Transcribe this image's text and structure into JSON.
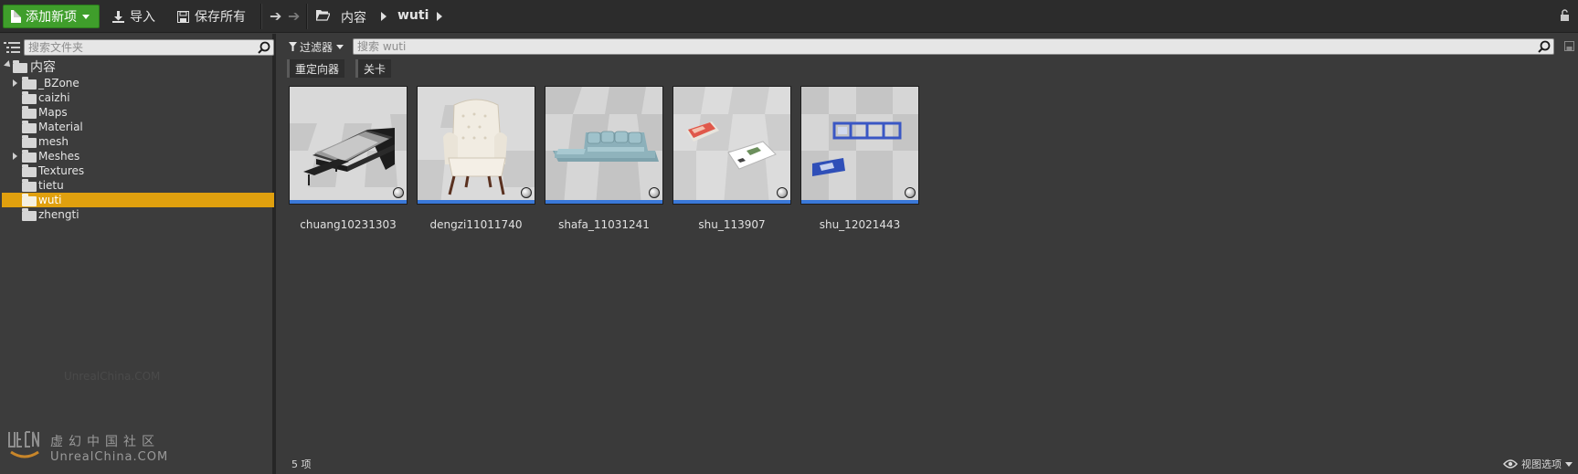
{
  "toolbar": {
    "add_new_label": "添加新项",
    "import_label": "导入",
    "save_all_label": "保存所有",
    "breadcrumb": [
      "内容",
      "wuti"
    ]
  },
  "sources": {
    "search_placeholder": "搜索文件夹",
    "tree": {
      "root": "内容",
      "items": [
        {
          "label": "_BZone",
          "expandable": true
        },
        {
          "label": "caizhi",
          "expandable": false
        },
        {
          "label": "Maps",
          "expandable": false
        },
        {
          "label": "Material",
          "expandable": false
        },
        {
          "label": "mesh",
          "expandable": false
        },
        {
          "label": "Meshes",
          "expandable": true
        },
        {
          "label": "Textures",
          "expandable": false
        },
        {
          "label": "tietu",
          "expandable": false
        },
        {
          "label": "wuti",
          "expandable": false,
          "selected": true
        },
        {
          "label": "zhengti",
          "expandable": false
        }
      ]
    }
  },
  "content": {
    "filter_label": "过滤器",
    "search_placeholder": "搜索 wuti",
    "chips": [
      "重定向器",
      "关卡"
    ],
    "assets": [
      {
        "name": "chuang10231303",
        "icon": "bed-thumbnail"
      },
      {
        "name": "dengzi11011740",
        "icon": "armchair-thumbnail"
      },
      {
        "name": "shafa_11031241",
        "icon": "sofa-thumbnail"
      },
      {
        "name": "shu_113907",
        "icon": "books-thumbnail"
      },
      {
        "name": "shu_12021443",
        "icon": "shelf-thumbnail"
      }
    ],
    "item_count": "5 项",
    "view_options_label": "视图选项"
  },
  "watermark": {
    "faint_text": "UnrealChina.COM",
    "logo_cn": "虚幻中国社区",
    "logo_en": "UnrealChina.COM"
  },
  "colors": {
    "add_button": "#3f9e2b",
    "selected_folder": "#e0a00e",
    "asset_bar": "#3a78d8"
  }
}
